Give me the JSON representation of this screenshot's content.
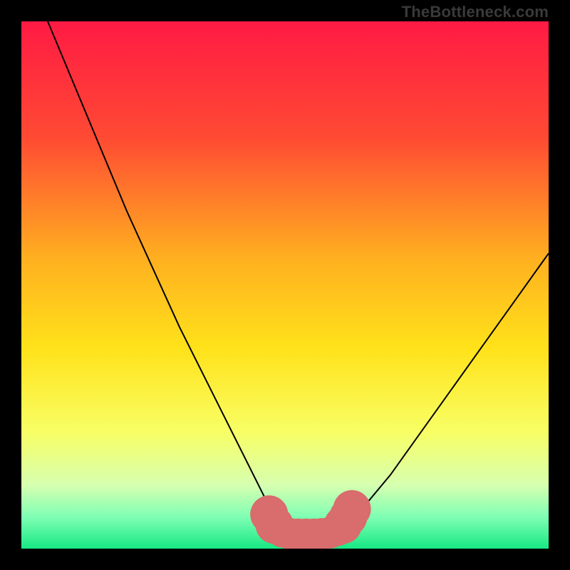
{
  "watermark": "TheBottleneck.com",
  "colors": {
    "bg_black": "#000000",
    "grad_top": "#ff1a44",
    "grad_mid1": "#ff6a2a",
    "grad_mid2": "#ffd21a",
    "grad_low1": "#f8ff66",
    "grad_low2": "#b6ffb0",
    "grad_bottom": "#17e884",
    "curve": "#000000",
    "marker": "#d96c6c"
  },
  "chart_data": {
    "type": "line",
    "title": "",
    "xlabel": "",
    "ylabel": "",
    "xlim": [
      0,
      100
    ],
    "ylim": [
      0,
      100
    ],
    "series": [
      {
        "name": "bottleneck-curve",
        "x": [
          5,
          10,
          15,
          20,
          25,
          30,
          35,
          40,
          45,
          47,
          50,
          53,
          55,
          57,
          59,
          61,
          65,
          70,
          75,
          80,
          85,
          90,
          95,
          100
        ],
        "y": [
          100,
          88,
          76,
          64,
          53,
          42,
          32,
          22,
          12,
          8,
          4,
          3,
          3,
          3,
          3,
          4,
          8,
          14,
          21,
          28,
          35,
          42,
          49,
          56
        ]
      }
    ],
    "markers": [
      {
        "name": "marker",
        "x": 47,
        "y": 6.5,
        "r": 1.2
      },
      {
        "name": "marker",
        "x": 48,
        "y": 4.5,
        "r": 1.2
      },
      {
        "name": "marker",
        "x": 49.5,
        "y": 3.2,
        "r": 1.0
      },
      {
        "name": "marker",
        "x": 51,
        "y": 2.8,
        "r": 1.0
      },
      {
        "name": "marker",
        "x": 52.5,
        "y": 2.7,
        "r": 1.0
      },
      {
        "name": "marker",
        "x": 54,
        "y": 2.7,
        "r": 1.0
      },
      {
        "name": "marker",
        "x": 55.5,
        "y": 2.7,
        "r": 1.0
      },
      {
        "name": "marker",
        "x": 57,
        "y": 2.8,
        "r": 1.0
      },
      {
        "name": "marker",
        "x": 58.5,
        "y": 3.0,
        "r": 1.0
      },
      {
        "name": "marker",
        "x": 60,
        "y": 3.5,
        "r": 1.0
      },
      {
        "name": "marker",
        "x": 61,
        "y": 4.5,
        "r": 1.2
      },
      {
        "name": "marker",
        "x": 62,
        "y": 6.0,
        "r": 1.2
      },
      {
        "name": "marker",
        "x": 62.7,
        "y": 7.5,
        "r": 1.2
      }
    ],
    "gradient_stops": [
      {
        "offset": 0,
        "color": "#ff1a44"
      },
      {
        "offset": 22,
        "color": "#ff4a33"
      },
      {
        "offset": 45,
        "color": "#ffb020"
      },
      {
        "offset": 62,
        "color": "#ffe21a"
      },
      {
        "offset": 78,
        "color": "#f8ff66"
      },
      {
        "offset": 88,
        "color": "#d6ffb0"
      },
      {
        "offset": 94,
        "color": "#7fffb4"
      },
      {
        "offset": 100,
        "color": "#17e884"
      }
    ]
  }
}
